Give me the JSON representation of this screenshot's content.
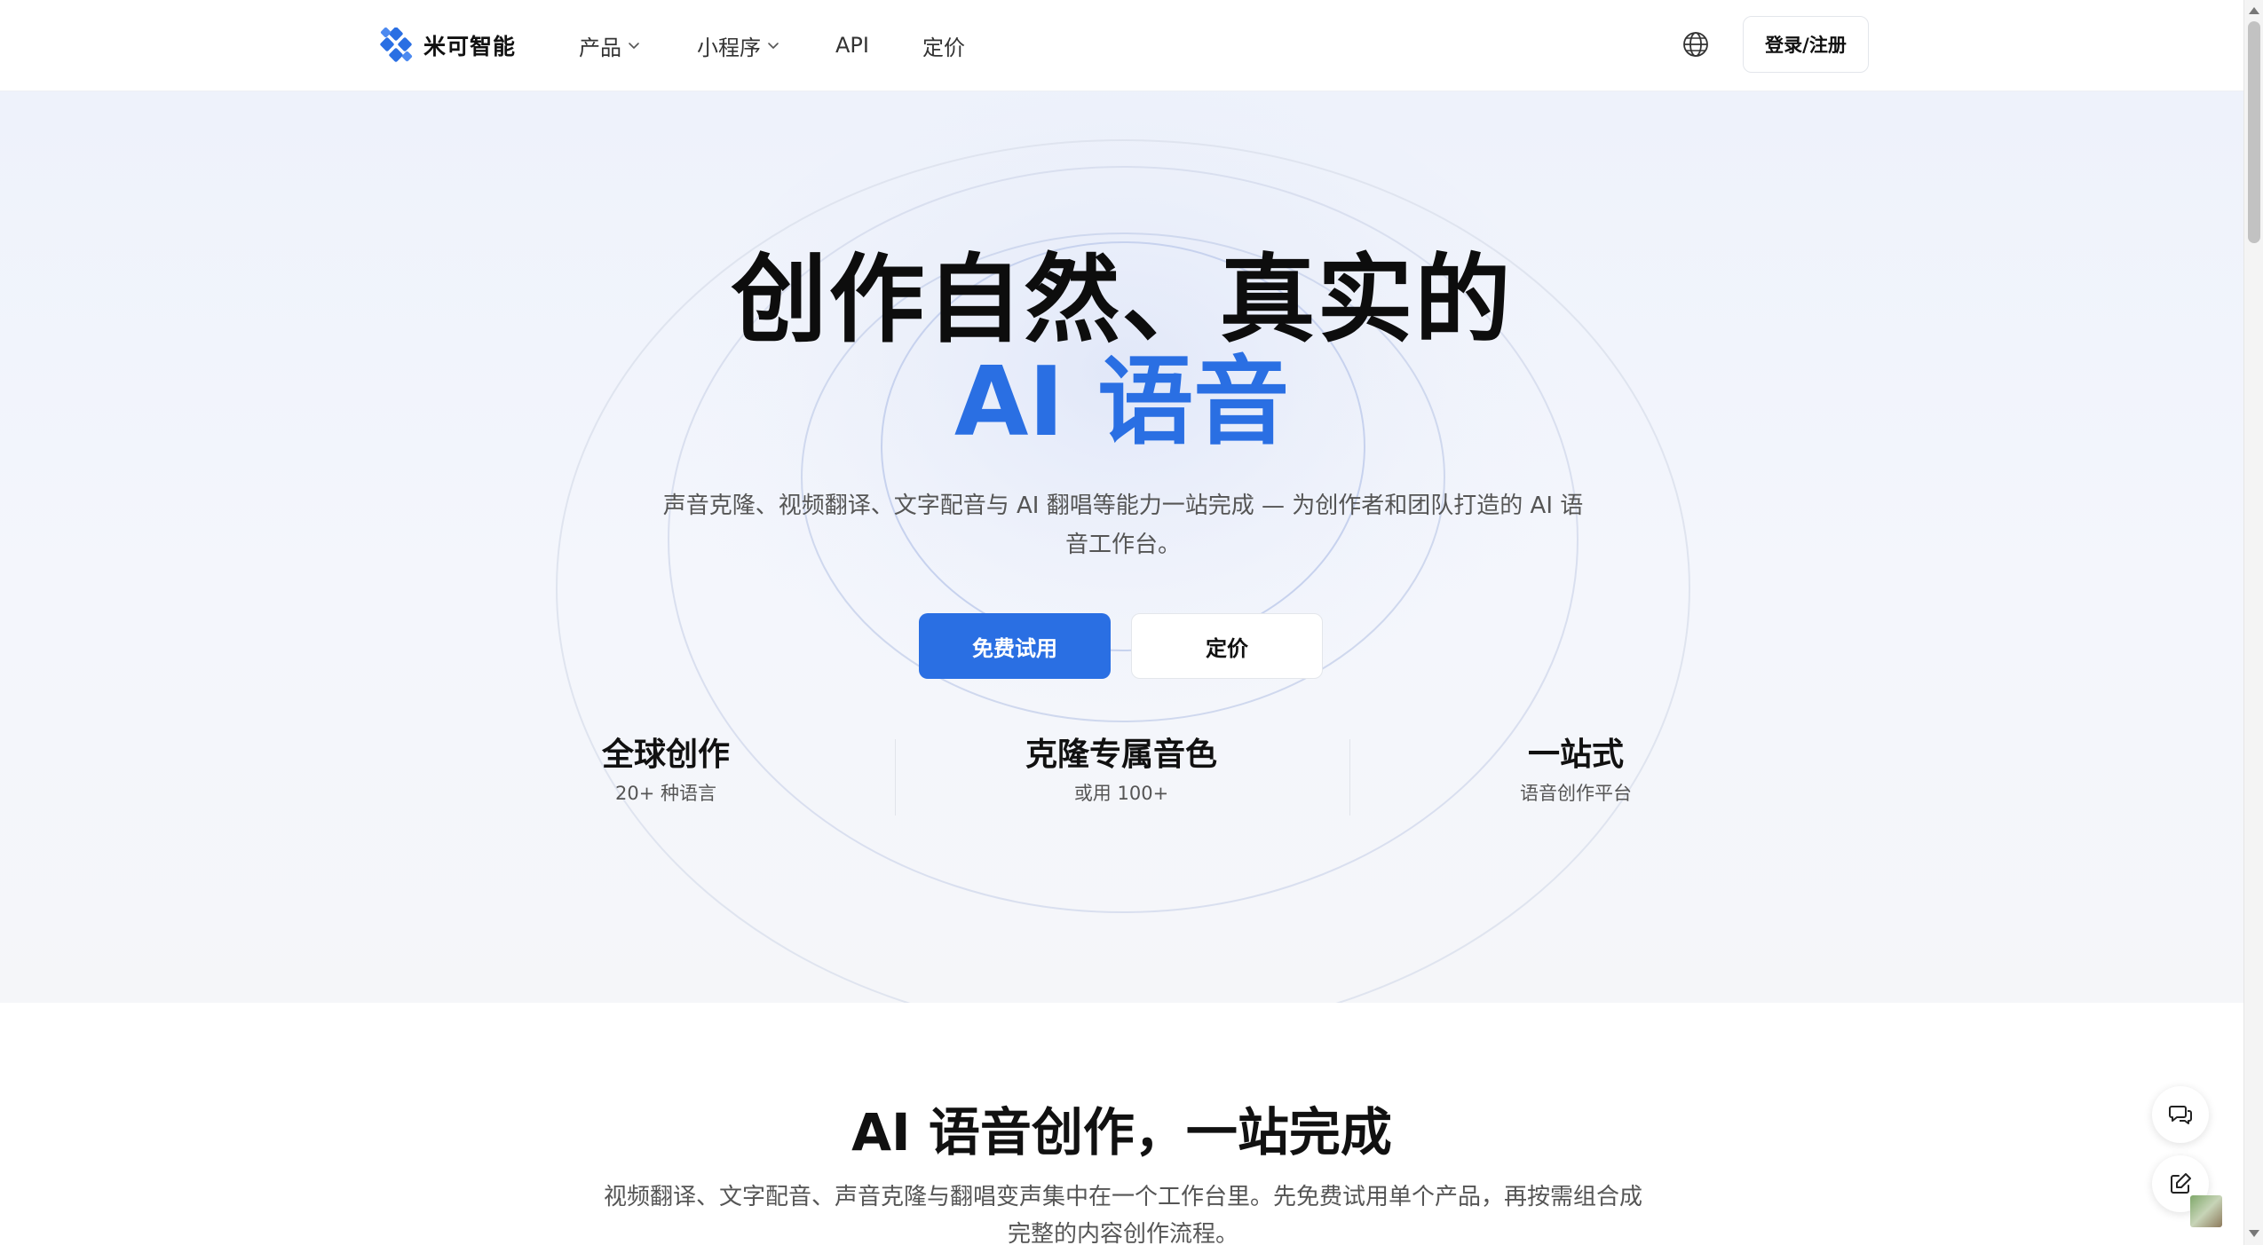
{
  "brand": {
    "name": "米可智能",
    "logo_icon": "diamond-grid-logo",
    "accent_color": "#2a6fe3"
  },
  "nav": {
    "products_label": "产品",
    "mini_program_label": "小程序",
    "api_label": "API",
    "pricing_label": "定价",
    "language_icon": "globe-icon",
    "login_label": "登录/注册"
  },
  "hero": {
    "title_line1": "创作自然、真实的",
    "title_line2": "AI 语音",
    "subtitle": "声音克隆、视频翻译、文字配音与 AI 翻唱等能力一站完成 — 为创作者和团队打造的 AI 语音工作台。",
    "primary_button": "免费试用",
    "secondary_button": "定价",
    "stats": [
      {
        "title": "全球创作",
        "subtitle": "20+ 种语言"
      },
      {
        "title": "克隆专属音色",
        "subtitle": "或用 100+"
      },
      {
        "title": "一站式",
        "subtitle": "语音创作平台"
      }
    ]
  },
  "section": {
    "title": "AI 语音创作，一站完成",
    "subtitle": "视频翻译、文字配音、声音克隆与翻唱变声集中在一个工作台里。先免费试用单个产品，再按需组合成完整的内容创作流程。"
  },
  "floating": {
    "chat_icon": "chat-bubbles-icon",
    "edit_icon": "edit-icon"
  }
}
